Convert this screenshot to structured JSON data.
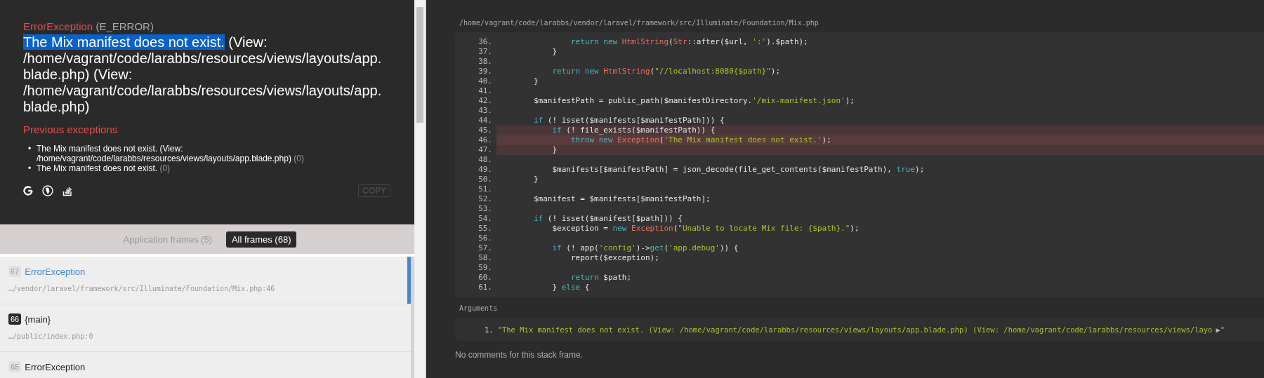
{
  "exception": {
    "type": "ErrorException",
    "code": "(E_ERROR)",
    "message": {
      "selected_part": "The Mix manifest does not exist.",
      "rest": "(View: /home/vagrant/code/larabbs/resources/views/layouts/app.blade.php) (View: /home/vagrant/code/larabbs/resources/views/layouts/app.blade.php)",
      "selection_shown": true
    }
  },
  "previous": {
    "heading": "Previous exceptions",
    "items": [
      {
        "marker": "•",
        "message": "The Mix manifest does not exist. (View: /home/vagrant/code/larabbs/resources/views/layouts/app.blade.php)",
        "code": "(0)"
      },
      {
        "marker": "•",
        "message": "The Mix manifest does not exist.",
        "code": "(0)"
      }
    ]
  },
  "copy_button": "COPY",
  "frame_tabs": [
    {
      "label": "Application frames (5)",
      "selected": false
    },
    {
      "label": "All frames (68)",
      "selected": true
    }
  ],
  "frames": [
    {
      "number": "67",
      "title": "ErrorException",
      "path": "…/vendor/laravel/framework/src/Illuminate/Foundation/Mix.php:46",
      "application": false,
      "selected": true
    },
    {
      "number": "66",
      "title": "{main}",
      "path": "…/public/index.php:0",
      "application": true,
      "selected": false
    },
    {
      "number": "65",
      "title": "ErrorException",
      "application": false,
      "selected": false
    }
  ],
  "file_path": "/home/vagrant/code/larabbs/vendor/laravel/framework/src/Illuminate/Foundation/Mix.php",
  "code_lines": [
    {
      "number": "36.",
      "highlighted": false,
      "current": false,
      "tokens": [
        {
          "kind": "keyword",
          "text": "                return new "
        },
        {
          "kind": "class",
          "text": "HtmlString"
        },
        {
          "kind": "plain",
          "text": "("
        },
        {
          "kind": "class",
          "text": "Str"
        },
        {
          "kind": "plain",
          "text": "::after($url, "
        },
        {
          "kind": "string",
          "text": "':'"
        },
        {
          "kind": "plain",
          "text": ").$path);"
        }
      ]
    },
    {
      "number": "37.",
      "highlighted": false,
      "current": false,
      "tokens": [
        {
          "kind": "plain",
          "text": "            }"
        }
      ]
    },
    {
      "number": "38.",
      "highlighted": false,
      "current": false
    },
    {
      "number": "39.",
      "highlighted": false,
      "current": false,
      "tokens": [
        {
          "kind": "keyword",
          "text": "            return new "
        },
        {
          "kind": "class",
          "text": "HtmlString"
        },
        {
          "kind": "plain",
          "text": "("
        },
        {
          "kind": "string",
          "text": "\"//localhost:8080{$path}\""
        },
        {
          "kind": "plain",
          "text": ");"
        }
      ]
    },
    {
      "number": "40.",
      "highlighted": false,
      "current": false,
      "tokens": [
        {
          "kind": "plain",
          "text": "        }"
        }
      ]
    },
    {
      "number": "41.",
      "highlighted": false,
      "current": false
    },
    {
      "number": "42.",
      "highlighted": false,
      "current": false,
      "tokens": [
        {
          "kind": "plain",
          "text": "        $manifestPath = public_path($manifestDirectory."
        },
        {
          "kind": "string",
          "text": "'/mix-manifest.json'"
        },
        {
          "kind": "plain",
          "text": ");"
        }
      ]
    },
    {
      "number": "43.",
      "highlighted": false,
      "current": false
    },
    {
      "number": "44.",
      "highlighted": false,
      "current": false,
      "tokens": [
        {
          "kind": "keyword",
          "text": "        if"
        },
        {
          "kind": "plain",
          "text": " (! isset($manifests[$manifestPath])) {"
        }
      ]
    },
    {
      "number": "45.",
      "highlighted": true,
      "current": false,
      "tokens": [
        {
          "kind": "keyword",
          "text": "            if"
        },
        {
          "kind": "plain",
          "text": " (! file_exists($manifestPath)) {"
        }
      ]
    },
    {
      "number": "46.",
      "highlighted": true,
      "current": true,
      "tokens": [
        {
          "kind": "keyword",
          "text": "                throw new "
        },
        {
          "kind": "class",
          "text": "Exception"
        },
        {
          "kind": "plain",
          "text": "("
        },
        {
          "kind": "string",
          "text": "'The Mix manifest does not exist.'"
        },
        {
          "kind": "plain",
          "text": ");"
        }
      ]
    },
    {
      "number": "47.",
      "highlighted": true,
      "current": false,
      "tokens": [
        {
          "kind": "plain",
          "text": "            }"
        }
      ]
    },
    {
      "number": "48.",
      "highlighted": false,
      "current": false
    },
    {
      "number": "49.",
      "highlighted": false,
      "current": false,
      "tokens": [
        {
          "kind": "plain",
          "text": "            $manifests[$manifestPath] = json_decode(file_get_contents($manifestPath), "
        },
        {
          "kind": "keyword",
          "text": "true"
        },
        {
          "kind": "plain",
          "text": ");"
        }
      ]
    },
    {
      "number": "50.",
      "highlighted": false,
      "current": false,
      "tokens": [
        {
          "kind": "plain",
          "text": "        }"
        }
      ]
    },
    {
      "number": "51.",
      "highlighted": false,
      "current": false
    },
    {
      "number": "52.",
      "highlighted": false,
      "current": false,
      "tokens": [
        {
          "kind": "plain",
          "text": "        $manifest = $manifests[$manifestPath];"
        }
      ]
    },
    {
      "number": "53.",
      "highlighted": false,
      "current": false
    },
    {
      "number": "54.",
      "highlighted": false,
      "current": false,
      "tokens": [
        {
          "kind": "keyword",
          "text": "        if"
        },
        {
          "kind": "plain",
          "text": " (! isset($manifest[$path])) {"
        }
      ]
    },
    {
      "number": "55.",
      "highlighted": false,
      "current": false,
      "tokens": [
        {
          "kind": "plain",
          "text": "            $exception = "
        },
        {
          "kind": "keyword",
          "text": "new "
        },
        {
          "kind": "class",
          "text": "Exception"
        },
        {
          "kind": "plain",
          "text": "("
        },
        {
          "kind": "string",
          "text": "\"Unable to locate Mix file: {$path}.\""
        },
        {
          "kind": "plain",
          "text": ");"
        }
      ]
    },
    {
      "number": "56.",
      "highlighted": false,
      "current": false
    },
    {
      "number": "57.",
      "highlighted": false,
      "current": false,
      "tokens": [
        {
          "kind": "keyword",
          "text": "            if"
        },
        {
          "kind": "plain",
          "text": " (! app("
        },
        {
          "kind": "string",
          "text": "'config'"
        },
        {
          "kind": "plain",
          "text": ")->"
        },
        {
          "kind": "keyword",
          "text": "get"
        },
        {
          "kind": "plain",
          "text": "("
        },
        {
          "kind": "string",
          "text": "'app.debug'"
        },
        {
          "kind": "plain",
          "text": ")) {"
        }
      ]
    },
    {
      "number": "58.",
      "highlighted": false,
      "current": false,
      "tokens": [
        {
          "kind": "plain",
          "text": "                report($exception);"
        }
      ]
    },
    {
      "number": "59.",
      "highlighted": false,
      "current": false
    },
    {
      "number": "60.",
      "highlighted": false,
      "current": false,
      "tokens": [
        {
          "kind": "keyword",
          "text": "                return"
        },
        {
          "kind": "plain",
          "text": " $path;"
        }
      ]
    },
    {
      "number": "61.",
      "highlighted": false,
      "current": false,
      "tokens": [
        {
          "kind": "plain",
          "text": "            } "
        },
        {
          "kind": "keyword",
          "text": "else"
        },
        {
          "kind": "plain",
          "text": " {"
        }
      ]
    }
  ],
  "arguments": {
    "heading": "Arguments",
    "items": [
      {
        "number": "1.",
        "value": "\"The Mix manifest does not exist. (View: /home/vagrant/code/larabbs/resources/views/layouts/app.blade.php) (View: /home/vagrant/code/larabbs/resources/views/layo",
        "toggle": "▶",
        "closing": "\""
      }
    ]
  },
  "comments_note": "No comments for this stack frame."
}
